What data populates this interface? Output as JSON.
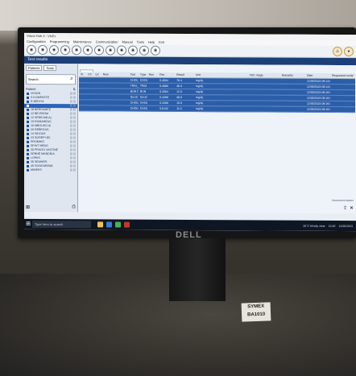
{
  "app": {
    "title": "Vision Hub 4 - VisEx",
    "menu": [
      "Configuration",
      "Programming",
      "Maintenance",
      "Communication",
      "Manual",
      "Tools",
      "Help",
      "Exit"
    ]
  },
  "header": {
    "title": "Test results"
  },
  "left_panel": {
    "tabs": [
      "Patients",
      "Tests"
    ],
    "search_placeholder": "Search",
    "tree_header": "Patient",
    "items": [
      {
        "label": "VISION",
        "selected": false
      },
      {
        "label": "S KOMPASTE",
        "selected": false
      },
      {
        "label": "R BEDIYA",
        "selected": false
      },
      {
        "label": "",
        "selected": true
      },
      {
        "label": "18 BERRAMFE",
        "selected": false
      },
      {
        "label": "12 BEJSSOM",
        "selected": false
      },
      {
        "label": "12 SENEJAB AL",
        "selected": false
      },
      {
        "label": "19 ROMANEAS",
        "selected": false
      },
      {
        "label": "10 MBOUKO AI",
        "selected": false
      },
      {
        "label": "20 REBEGAS",
        "selected": false
      },
      {
        "label": "14 SIDOAS",
        "selected": false
      },
      {
        "label": "23 SOREPI BS",
        "selected": false
      },
      {
        "label": "PROMHIG",
        "selected": false
      },
      {
        "label": "SPIUT MEAS",
        "selected": false
      },
      {
        "label": "30 PRAGO VASTINE",
        "selected": false
      },
      {
        "label": "SEBNE MANDRIA",
        "selected": false
      },
      {
        "label": "LOPAS",
        "selected": false
      },
      {
        "label": "35 SEAWRS",
        "selected": false
      },
      {
        "label": "45 SONOUBPAB",
        "selected": false
      },
      {
        "label": "MINEKS",
        "selected": false
      }
    ]
  },
  "results": {
    "tab": "Tests",
    "columns": [
      "St",
      "Ch",
      "Lic",
      "New",
      "Test",
      "Type",
      "Res",
      "Rec",
      "Result",
      "Unit",
      "Ref. range",
      "Remarks",
      "Date",
      "Requested mode"
    ],
    "rows": [
      [
        "",
        "",
        "",
        "",
        "CHOL_PRO_CERRO",
        "CHOL",
        "",
        "0.4004",
        "78.4",
        "mg/dL",
        "",
        "",
        "12/05/2023 09:14:05",
        ""
      ],
      [
        "",
        "",
        "",
        "",
        "TRIG_PRO_CERRO",
        "TRIG",
        "",
        "0.4880",
        "46.0",
        "mg/dL",
        "",
        "",
        "12/05/2023 09:14:05",
        ""
      ],
      [
        "",
        "",
        "",
        "",
        "BUN CREALA",
        "BUN",
        "",
        "0.2064",
        "12.0",
        "mg/dL",
        "",
        "",
        "12/05/2023 09:16:05",
        ""
      ],
      [
        "",
        "",
        "",
        "",
        "GLUC PT",
        "GLUC",
        "",
        "0.4458",
        "48.0",
        "mg/dL",
        "",
        "",
        "12/05/2023 09:16:05",
        ""
      ],
      [
        "",
        "",
        "",
        "",
        "CHOLPT+CERRO",
        "CHOL",
        "",
        "0.3306",
        "15.0",
        "mg/dL",
        "",
        "",
        "12/05/2023 09:16:05",
        ""
      ],
      [
        "",
        "",
        "",
        "",
        "CHOLPT",
        "CHOL",
        "",
        "0.6132",
        "11.0",
        "mg/dL",
        "",
        "",
        "12/05/2023 09:16:05",
        ""
      ]
    ]
  },
  "status_text": "Instrument status",
  "taskbar": {
    "search_placeholder": "Type here to search",
    "weather": "30°C  Mostly clear",
    "time": "10:45",
    "date": "12/05/2023"
  },
  "monitor_brand": "DELL",
  "sticker": {
    "line1": "SYMEX",
    "line2": "BA1010"
  }
}
